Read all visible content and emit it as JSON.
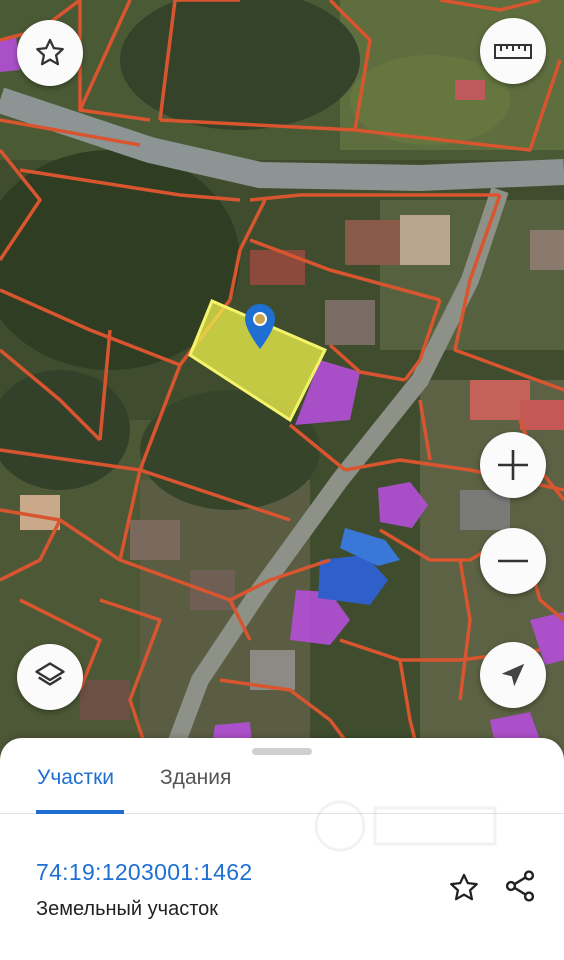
{
  "map": {
    "controls": {
      "favorite": "star-outline-icon",
      "measure": "ruler-icon",
      "zoom_in": "plus-icon",
      "zoom_out": "minus-icon",
      "layers": "layers-icon",
      "locate": "navigation-arrow-icon"
    },
    "colors": {
      "parcel_border": "#d9552f",
      "selected_parcel": "#e9ec4a",
      "building_highlight": "#b44fd8",
      "road": "#8d9494"
    }
  },
  "sheet": {
    "tabs": [
      {
        "label": "Участки",
        "active": true
      },
      {
        "label": "Здания",
        "active": false
      }
    ],
    "parcel": {
      "cadastral_number": "74:19:1203001:1462",
      "type": "Земельный участок"
    },
    "accent_color": "#1f6fd3"
  }
}
